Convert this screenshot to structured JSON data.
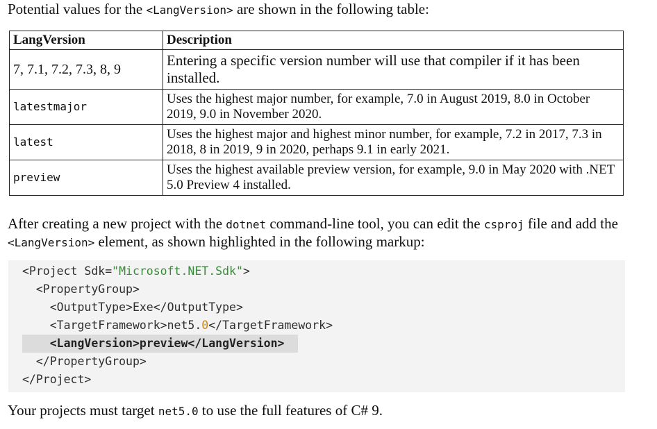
{
  "intro": {
    "before": "Potential values for the ",
    "code": "<LangVersion>",
    "after": " are shown in the following table:"
  },
  "table": {
    "headers": [
      "LangVersion",
      "Description"
    ],
    "rows": [
      {
        "value": "7, 7.1, 7.2, 7.3, 8, 9",
        "description": "Entering a specific version number will use that compiler if it has been installed."
      },
      {
        "value": "latestmajor",
        "description": "Uses the highest major number, for example, 7.0 in August 2019, 8.0 in October 2019, 9.0 in November 2020."
      },
      {
        "value": "latest",
        "description": "Uses the highest major and highest minor number, for example, 7.2 in 2017, 7.3 in 2018, 8 in 2019, 9 in 2020, perhaps 9.1 in early 2021."
      },
      {
        "value": "preview",
        "description": "Uses the highest available preview version, for example, 9.0 in May 2020 with .NET 5.0 Preview 4 installed."
      }
    ]
  },
  "para2": {
    "t1": "After creating a new project with the ",
    "c1": "dotnet",
    "t2": " command-line tool, you can edit the ",
    "c2": "csproj",
    "t3": " file and add the ",
    "c3": "<LangVersion>",
    "t4": " element, as shown highlighted in the following markup:"
  },
  "code": {
    "l1_open": "<Project Sdk=",
    "l1_str": "\"Microsoft.NET.Sdk\"",
    "l1_close": ">",
    "l2": "  <PropertyGroup>",
    "l3": "    <OutputType>Exe</OutputType>",
    "l4_a": "    <TargetFramework>net5.",
    "l4_num": "0",
    "l4_b": "</TargetFramework>",
    "l5": "    <LangVersion>preview</LangVersion>",
    "l6": "  </PropertyGroup>",
    "l7": "</Project>"
  },
  "para3": {
    "t1": "Your projects must target ",
    "c1": "net5.0",
    "t2": " to use the full features of C# 9."
  }
}
